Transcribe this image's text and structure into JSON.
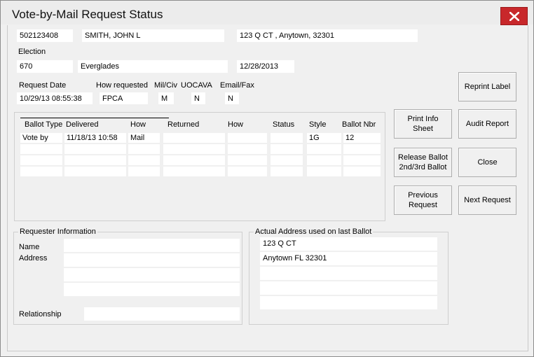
{
  "window": {
    "title": "Vote-by-Mail Request Status"
  },
  "voter": {
    "id": "502123408",
    "name": "SMITH, JOHN L",
    "address": "123 Q CT , Anytown, 32301"
  },
  "election": {
    "label": "Election",
    "number": "670",
    "name": "Everglades",
    "date": "12/28/2013"
  },
  "request": {
    "date_label": "Request Date",
    "date": "10/29/13 08:55:38",
    "how_label": "How requested",
    "how": "FPCA",
    "milciv_label": "Mil/Civ",
    "milciv": "M",
    "uocava_label": "UOCAVA",
    "uocava": "N",
    "emailfax_label": "Email/Fax",
    "emailfax": "N"
  },
  "ballots": {
    "columns": [
      "Ballot Type",
      "Delivered",
      "How",
      "Returned",
      "How",
      "Status",
      "Style",
      "Ballot Nbr"
    ],
    "rows": [
      [
        "Vote by",
        "11/18/13 10:58",
        "Mail",
        "",
        "",
        "",
        "1G",
        "12"
      ],
      [
        "",
        "",
        "",
        "",
        "",
        "",
        "",
        ""
      ],
      [
        "",
        "",
        "",
        "",
        "",
        "",
        "",
        ""
      ],
      [
        "",
        "",
        "",
        "",
        "",
        "",
        "",
        ""
      ]
    ]
  },
  "buttons": {
    "reprint_label": "Reprint Label",
    "print_info": "Print Info\nSheet",
    "audit_report": "Audit Report",
    "release_ballot": "Release Ballot\n2nd/3rd Ballot",
    "close": "Close",
    "previous_request": "Previous\nRequest",
    "next_request": "Next Request"
  },
  "requester": {
    "group_title": "Requester Information",
    "name_label": "Name",
    "address_label": "Address",
    "relationship_label": "Relationship",
    "name": "",
    "address_lines": [
      "",
      "",
      ""
    ],
    "relationship": ""
  },
  "actual_address": {
    "group_title": "Actual Address used on last Ballot",
    "lines": [
      "123 Q CT",
      "Anytown FL 32301",
      "",
      "",
      ""
    ]
  }
}
